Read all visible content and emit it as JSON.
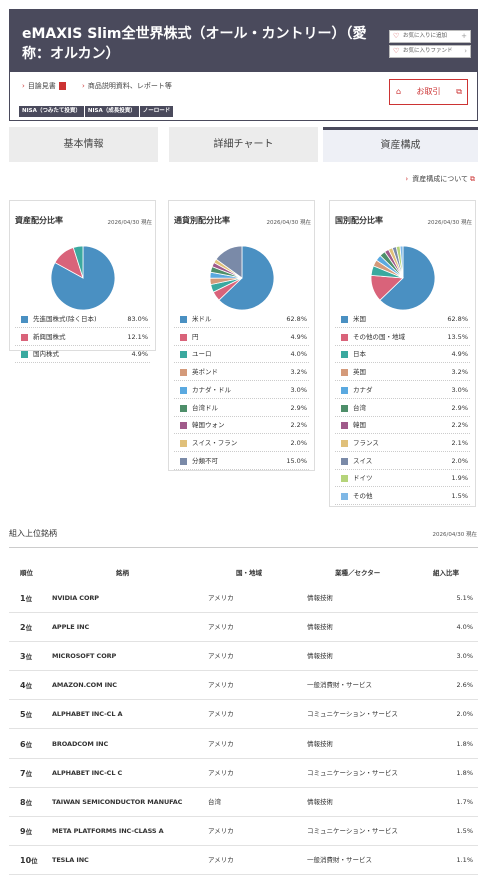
{
  "header": {
    "title": "eMAXIS Slim全世界株式（オール・カントリー）（愛称：オルカン）",
    "fav_add": "お気に入りに追加",
    "fav_funds": "お気に入りファンド",
    "link_prospectus": "目論見書",
    "link_reports": "商品説明資料、レポート等",
    "badges": [
      "NISA（つみたて投資）",
      "NISA（成長投資）",
      "ノーロード"
    ],
    "trade_button": "お取引"
  },
  "tabs": [
    "基本情報",
    "詳細チャート",
    "資産構成"
  ],
  "active_tab": 2,
  "about_link": "資産構成について",
  "panels": [
    {
      "title": "資産配分比率",
      "date": "2026/04/30 現在",
      "items": [
        {
          "name": "先進国株式(除く日本)",
          "value": 83.0,
          "label": "83.0%",
          "color": "#4a90c2"
        },
        {
          "name": "新興国株式",
          "value": 12.1,
          "label": "12.1%",
          "color": "#d9637a"
        },
        {
          "name": "国内株式",
          "value": 4.9,
          "label": "4.9%",
          "color": "#3aa99f"
        }
      ]
    },
    {
      "title": "通貨別配分比率",
      "date": "2026/04/30 現在",
      "items": [
        {
          "name": "米ドル",
          "value": 62.8,
          "label": "62.8%",
          "color": "#4a90c2"
        },
        {
          "name": "円",
          "value": 4.9,
          "label": "4.9%",
          "color": "#d9637a"
        },
        {
          "name": "ユーロ",
          "value": 4.0,
          "label": "4.0%",
          "color": "#3aa99f"
        },
        {
          "name": "英ポンド",
          "value": 3.2,
          "label": "3.2%",
          "color": "#d49a7a"
        },
        {
          "name": "カナダ・ドル",
          "value": 3.0,
          "label": "3.0%",
          "color": "#5aa9e0"
        },
        {
          "name": "台湾ドル",
          "value": 2.9,
          "label": "2.9%",
          "color": "#4e8f6a"
        },
        {
          "name": "韓国ウォン",
          "value": 2.2,
          "label": "2.2%",
          "color": "#a05a8a"
        },
        {
          "name": "スイス・フラン",
          "value": 2.0,
          "label": "2.0%",
          "color": "#e0c07a"
        },
        {
          "name": "分類不可",
          "value": 15.0,
          "label": "15.0%",
          "color": "#7a8aa8"
        }
      ]
    },
    {
      "title": "国別配分比率",
      "date": "2026/04/30 現在",
      "items": [
        {
          "name": "米国",
          "value": 62.8,
          "label": "62.8%",
          "color": "#4a90c2"
        },
        {
          "name": "その他の国・地域",
          "value": 13.5,
          "label": "13.5%",
          "color": "#d9637a"
        },
        {
          "name": "日本",
          "value": 4.9,
          "label": "4.9%",
          "color": "#3aa99f"
        },
        {
          "name": "英国",
          "value": 3.2,
          "label": "3.2%",
          "color": "#d49a7a"
        },
        {
          "name": "カナダ",
          "value": 3.0,
          "label": "3.0%",
          "color": "#5aa9e0"
        },
        {
          "name": "台湾",
          "value": 2.9,
          "label": "2.9%",
          "color": "#4e8f6a"
        },
        {
          "name": "韓国",
          "value": 2.2,
          "label": "2.2%",
          "color": "#a05a8a"
        },
        {
          "name": "フランス",
          "value": 2.1,
          "label": "2.1%",
          "color": "#e0c07a"
        },
        {
          "name": "スイス",
          "value": 2.0,
          "label": "2.0%",
          "color": "#7a8aa8"
        },
        {
          "name": "ドイツ",
          "value": 1.9,
          "label": "1.9%",
          "color": "#b5d47a"
        },
        {
          "name": "その他",
          "value": 1.5,
          "label": "1.5%",
          "color": "#7fb8e6"
        }
      ]
    }
  ],
  "holdings": {
    "title": "組入上位銘柄",
    "date": "2026/04/30 現在",
    "headers": [
      "順位",
      "銘柄",
      "国・地域",
      "業種／セクター",
      "組入比率"
    ],
    "rank_suffix": "位",
    "rows": [
      {
        "rank": "1",
        "name": "NVIDIA CORP",
        "country": "アメリカ",
        "sector": "情報技術",
        "pct": "5.1%"
      },
      {
        "rank": "2",
        "name": "APPLE INC",
        "country": "アメリカ",
        "sector": "情報技術",
        "pct": "4.0%"
      },
      {
        "rank": "3",
        "name": "MICROSOFT CORP",
        "country": "アメリカ",
        "sector": "情報技術",
        "pct": "3.0%"
      },
      {
        "rank": "4",
        "name": "AMAZON.COM INC",
        "country": "アメリカ",
        "sector": "一般消費財・サービス",
        "pct": "2.6%"
      },
      {
        "rank": "5",
        "name": "ALPHABET INC-CL A",
        "country": "アメリカ",
        "sector": "コミュニケーション・サービス",
        "pct": "2.0%"
      },
      {
        "rank": "6",
        "name": "BROADCOM INC",
        "country": "アメリカ",
        "sector": "情報技術",
        "pct": "1.8%"
      },
      {
        "rank": "7",
        "name": "ALPHABET INC-CL C",
        "country": "アメリカ",
        "sector": "コミュニケーション・サービス",
        "pct": "1.8%"
      },
      {
        "rank": "8",
        "name": "TAIWAN SEMICONDUCTOR MANUFAC",
        "country": "台湾",
        "sector": "情報技術",
        "pct": "1.7%"
      },
      {
        "rank": "9",
        "name": "META PLATFORMS INC-CLASS A",
        "country": "アメリカ",
        "sector": "コミュニケーション・サービス",
        "pct": "1.5%"
      },
      {
        "rank": "10",
        "name": "TESLA INC",
        "country": "アメリカ",
        "sector": "一般消費財・サービス",
        "pct": "1.1%"
      }
    ]
  },
  "chart_data": [
    {
      "type": "pie",
      "title": "資産配分比率",
      "labels": [
        "先進国株式(除く日本)",
        "新興国株式",
        "国内株式"
      ],
      "values": [
        83.0,
        12.1,
        4.9
      ]
    },
    {
      "type": "pie",
      "title": "通貨別配分比率",
      "labels": [
        "米ドル",
        "円",
        "ユーロ",
        "英ポンド",
        "カナダ・ドル",
        "台湾ドル",
        "韓国ウォン",
        "スイス・フラン",
        "分類不可"
      ],
      "values": [
        62.8,
        4.9,
        4.0,
        3.2,
        3.0,
        2.9,
        2.2,
        2.0,
        15.0
      ]
    },
    {
      "type": "pie",
      "title": "国別配分比率",
      "labels": [
        "米国",
        "その他の国・地域",
        "日本",
        "英国",
        "カナダ",
        "台湾",
        "韓国",
        "フランス",
        "スイス",
        "ドイツ",
        "その他"
      ],
      "values": [
        62.8,
        13.5,
        4.9,
        3.2,
        3.0,
        2.9,
        2.2,
        2.1,
        2.0,
        1.9,
        1.5
      ]
    }
  ]
}
